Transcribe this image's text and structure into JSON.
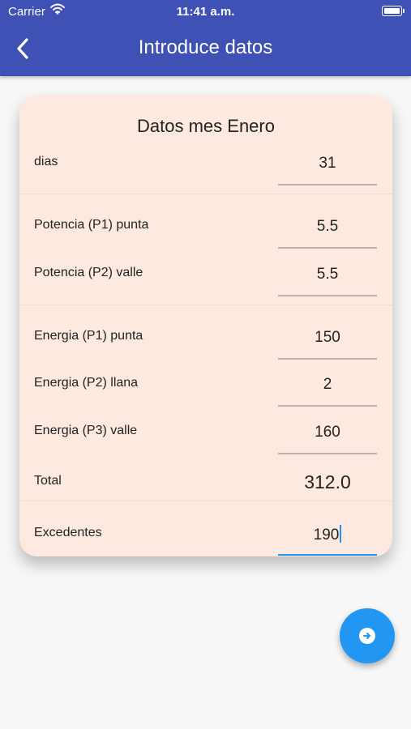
{
  "status_bar": {
    "carrier": "Carrier",
    "time": "11:41 a.m."
  },
  "app_bar": {
    "title": "Introduce datos",
    "back_icon": "chevron-left-icon",
    "background": "#3f51b5"
  },
  "card": {
    "title": "Datos mes Enero",
    "background": "#fde9df",
    "dias": {
      "label": "dias",
      "value": "31"
    },
    "potencia_p1": {
      "label": "Potencia (P1) punta",
      "value": "5.5"
    },
    "potencia_p2": {
      "label": "Potencia (P2) valle",
      "value": "5.5"
    },
    "energia_p1": {
      "label": "Energia (P1) punta",
      "value": "150"
    },
    "energia_p2": {
      "label": "Energia (P2) llana",
      "value": "2"
    },
    "energia_p3": {
      "label": "Energia (P3) valle",
      "value": "160"
    },
    "total": {
      "label": "Total",
      "value": "312.0"
    },
    "excedentes": {
      "label": "Excedentes",
      "value": "190"
    }
  },
  "fab": {
    "icon": "arrow-right-circle-icon",
    "color": "#2196f3"
  }
}
